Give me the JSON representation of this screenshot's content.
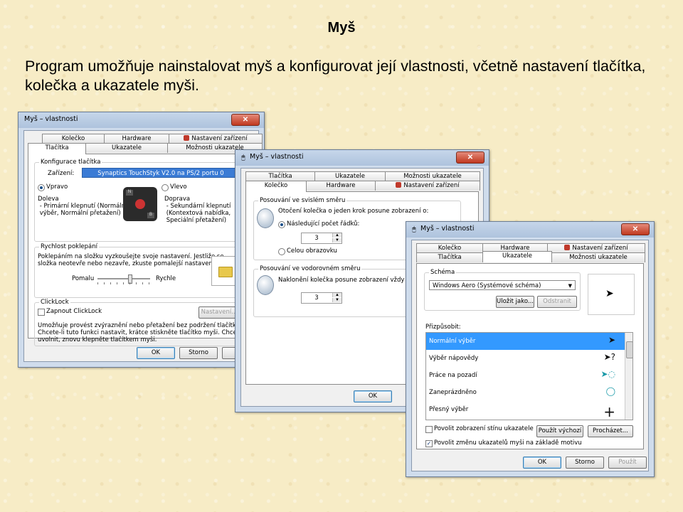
{
  "slide": {
    "title": "Myš",
    "body": "Program umožňuje nainstalovat myš a konfigurovat její vlastnosti, včetně nastavení tlačítka, kolečka a ukazatele myši."
  },
  "dialog1": {
    "title": "Myš – vlastnosti",
    "tabs_row1": [
      "Kolečko",
      "Hardware",
      "Nastavení zařízení"
    ],
    "tabs_row2": [
      "Tlačítka",
      "Ukazatele",
      "Možnosti ukazatele"
    ],
    "button_config": {
      "label": "Konfigurace tlačítka",
      "device_label": "Zařízení:",
      "device_value": "Synaptics TouchStyk V2.0 na PS/2 portu 0",
      "right_label": "Vpravo",
      "left_label": "Vlevo",
      "right_desc": "Doleva\n - Primární klepnutí (Normální\n výběr, Normální přetažení)",
      "left_desc": "Doprava\n - Sekundární klepnutí\n (Kontextová nabídka,\n Speciální přetažení)"
    },
    "double_click": {
      "label": "Rychlost poklepání",
      "desc": "Poklepáním na složku vyzkoušejte svoje nastavení. Jestliže se\nsložka neotevře nebo nezavře, zkuste pomalejší nastavení.",
      "slow": "Pomalu",
      "fast": "Rychle",
      "slider_fraction": 0.62
    },
    "clicklock": {
      "label": "ClickLock",
      "checkbox_label": "Zapnout ClickLock",
      "settings_button": "Nastavení...",
      "desc": "Umožňuje provést zvýraznění nebo přetažení bez podržení tlačítka myši.\nChcete-li tuto funkci nastavit, krátce stiskněte tlačítko myši. Chcete-li funkci\nuvolnit, znovu klepněte tlačítkem myši."
    },
    "ok": "OK",
    "cancel": "Storno",
    "apply": "Po"
  },
  "dialog2": {
    "title": "Myš – vlastnosti",
    "tabs_row1": [
      "Tlačítka",
      "Ukazatele",
      "Možnosti ukazatele"
    ],
    "tabs_row2": [
      "Kolečko",
      "Hardware",
      "Nastavení zařízení"
    ],
    "vertical": {
      "label": "Posouvání ve svislém směru",
      "desc": "Otočení kolečka o jeden krok posune zobrazení o:",
      "option1": "Následující počet řádků:",
      "option1_value": "3",
      "option2": "Celou obrazovku"
    },
    "horizontal": {
      "label": "Posouvání ve vodorovném směru",
      "desc": "Naklonění kolečka posune zobrazení vždy o tent",
      "value": "3"
    },
    "ok": "OK"
  },
  "dialog3": {
    "title": "Myš – vlastnosti",
    "tabs_row1": [
      "Kolečko",
      "Hardware",
      "Nastavení zařízení"
    ],
    "tabs_row2": [
      "Tlačítka",
      "Ukazatele",
      "Možnosti ukazatele"
    ],
    "scheme": {
      "label": "Schéma",
      "value": "Windows Aero (Systémové schéma)",
      "save_as": "Uložit jako...",
      "delete": "Odstranit"
    },
    "customize_label": "Přizpůsobit:",
    "cursors": [
      {
        "name": "Normální výběr",
        "icon": "arrow-icon",
        "selected": true
      },
      {
        "name": "Výběr nápovědy",
        "icon": "help-arrow-icon",
        "selected": false
      },
      {
        "name": "Práce na pozadí",
        "icon": "busy-arrow-icon",
        "selected": false
      },
      {
        "name": "Zaneprázdněno",
        "icon": "busy-ring-icon",
        "selected": false
      },
      {
        "name": "Přesný výběr",
        "icon": "crosshair-icon",
        "selected": false
      }
    ],
    "shadow_label": "Povolit zobrazení stínu ukazatele",
    "use_default": "Použít výchozí",
    "browse": "Procházet...",
    "theme_label": "Povolit změnu ukazatelů myši na základě motivu",
    "ok": "OK",
    "cancel": "Storno",
    "apply": "Použít"
  }
}
